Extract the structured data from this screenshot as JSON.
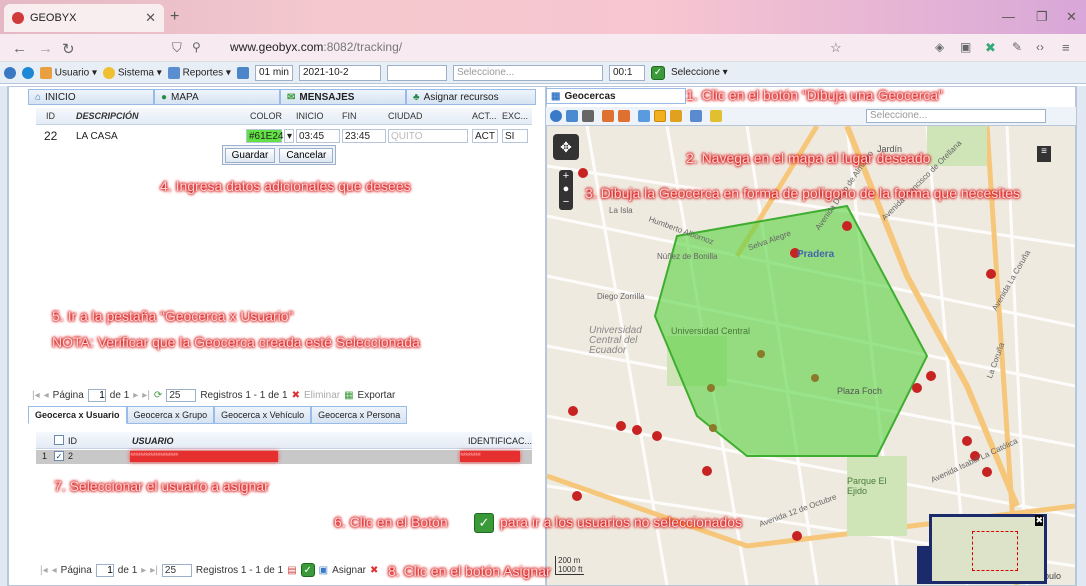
{
  "browser": {
    "tab_title": "GEOBYX",
    "url_host": "www.geobyx.com",
    "url_path": ":8082/tracking/"
  },
  "toolbar": {
    "usuario": "Usuario",
    "sistema": "Sistema",
    "reportes": "Reportes",
    "interval": "01 min",
    "date": "2021-10-2",
    "select_placeholder": "Seleccione...",
    "time": "00:1",
    "select_last": "Seleccione"
  },
  "tabs": [
    "INICIO",
    "MAPA",
    "MENSAJES",
    "Asignar recursos"
  ],
  "grid": {
    "headers": [
      "ID",
      "DESCRIPCIÓN",
      "COLOR",
      "INICIO",
      "FIN",
      "CIUDAD",
      "ACT...",
      "EXC..."
    ],
    "row": {
      "id": "22",
      "descripcion": "LA CASA",
      "color": "#61E24",
      "inicio": "03:45",
      "fin": "23:45",
      "ciudad": "QUITO",
      "act": "ACT",
      "exc": "SI"
    },
    "save": "Guardar",
    "cancel": "Cancelar"
  },
  "pager_top": {
    "pagina": "Página",
    "page": "1",
    "de": "de 1",
    "size": "25",
    "registros": "Registros 1 - 1 de 1",
    "eliminar": "Eliminar",
    "exportar": "Exportar"
  },
  "bottom_tabs": [
    "Geocerca x Usuario",
    "Geocerca x Grupo",
    "Geocerca x Vehículo",
    "Geocerca x Persona"
  ],
  "user_grid": {
    "headers": [
      "ID",
      "USUARIO",
      "IDENTIFICAC..."
    ],
    "row_num": "1",
    "row_id": "2",
    "masked_user": "*******************",
    "masked_id": "********"
  },
  "pager_bottom": {
    "pagina": "Página",
    "page": "1",
    "de": "de 1",
    "size": "25",
    "registros": "Registros 1 - 1 de 1",
    "asignar": "Asignar"
  },
  "map": {
    "tab": "Geocercas",
    "search_placeholder": "Seleccione...",
    "labels": [
      "Pradera",
      "Universidad Central del Ecuador",
      "Universidad Central",
      "Plaza Foch",
      "Parque El Ejido",
      "Jardín",
      "Guápulo",
      "Diego Zorrilla",
      "La Isla",
      "La Coruña",
      "Avenida 12 de Octubre",
      "Avenida Isabel La Católica",
      "Selva Alegre",
      "Núñez de Bonilla",
      "Humberto Albornoz",
      "Avenida Diego de Almagro",
      "Avenida La Coruña",
      "Avenida Francisco de Orellana"
    ],
    "scale_m": "200 m",
    "scale_ft": "1000 ft"
  },
  "annotations": {
    "a1": "1. Clic en el botón “Dibuja una Geocerca”",
    "a2": "2. Navega en el mapa al lugar deseado",
    "a3": "3. Dibuja la Geocerca en forma de polígono de la forma que necesites",
    "a4": "4. Ingresa datos adicionales que desees",
    "a5": "5. Ir a la pestaña “Geocerca x Usuario”",
    "a5b": "NOTA: Verificar que la Geocerca creada esté Seleccionada",
    "a6a": "6. Clic en el Botón",
    "a6b": "para ir a los usuarios no seleccionados",
    "a7": "7. Seleccionar el usuario a asignar",
    "a8": "8. Clic en el botón Asignar"
  }
}
